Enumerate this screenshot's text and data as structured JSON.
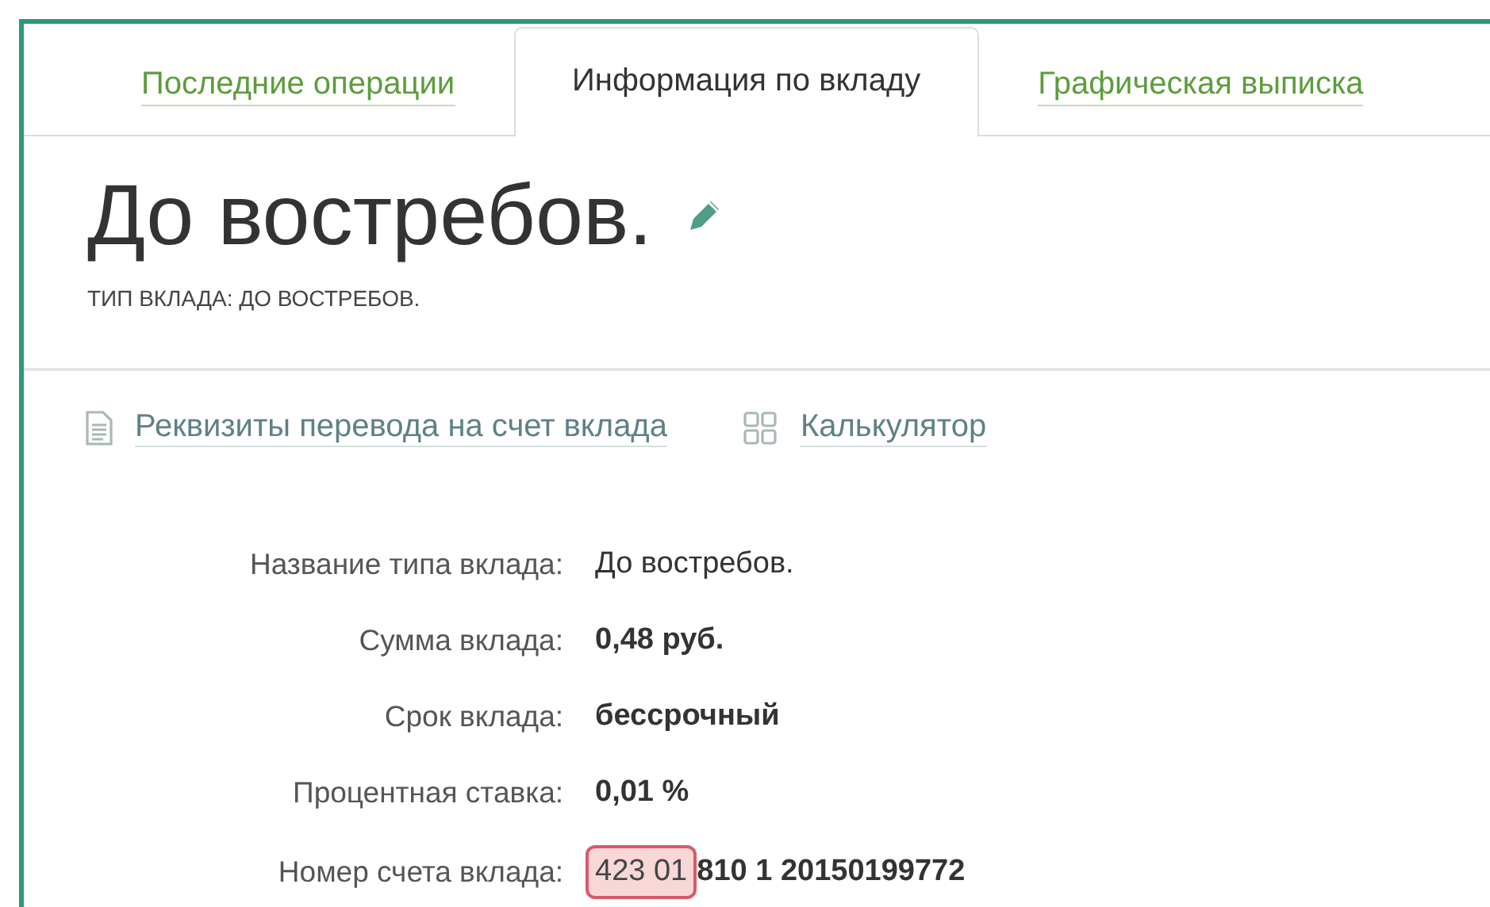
{
  "tabs": [
    {
      "label": "Последние операции",
      "selected": false
    },
    {
      "label": "Информация по вкладу",
      "selected": true
    },
    {
      "label": "Графическая выписка",
      "selected": false
    }
  ],
  "title": "До востребов.",
  "subtitle": "ТИП ВКЛАДА: ДО ВОСТРЕБОВ.",
  "links": [
    {
      "kind": "document",
      "label": "Реквизиты перевода на счет вклада"
    },
    {
      "kind": "calculator",
      "label": "Калькулятор"
    }
  ],
  "details": [
    {
      "label": "Название типа вклада:",
      "value": "До востребов.",
      "bold": false
    },
    {
      "label": "Сумма вклада:",
      "value": "0,48 руб.",
      "bold": true
    },
    {
      "label": "Срок вклада:",
      "value": "бессрочный",
      "bold": true
    },
    {
      "label": "Процентная ставка:",
      "value": "0,01 %",
      "bold": true
    },
    {
      "label": "Номер счета вклада:",
      "highlighted": "423 01",
      "value": "810 1 20150199772",
      "bold": true
    }
  ]
}
